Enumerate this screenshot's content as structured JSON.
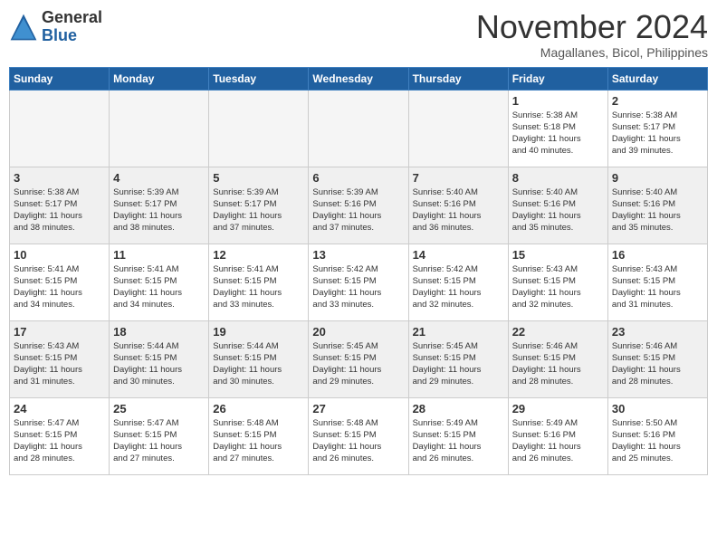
{
  "logo": {
    "general": "General",
    "blue": "Blue"
  },
  "title": "November 2024",
  "location": "Magallanes, Bicol, Philippines",
  "days_of_week": [
    "Sunday",
    "Monday",
    "Tuesday",
    "Wednesday",
    "Thursday",
    "Friday",
    "Saturday"
  ],
  "weeks": [
    [
      {
        "day": "",
        "info": ""
      },
      {
        "day": "",
        "info": ""
      },
      {
        "day": "",
        "info": ""
      },
      {
        "day": "",
        "info": ""
      },
      {
        "day": "",
        "info": ""
      },
      {
        "day": "1",
        "info": "Sunrise: 5:38 AM\nSunset: 5:18 PM\nDaylight: 11 hours\nand 40 minutes."
      },
      {
        "day": "2",
        "info": "Sunrise: 5:38 AM\nSunset: 5:17 PM\nDaylight: 11 hours\nand 39 minutes."
      }
    ],
    [
      {
        "day": "3",
        "info": "Sunrise: 5:38 AM\nSunset: 5:17 PM\nDaylight: 11 hours\nand 38 minutes."
      },
      {
        "day": "4",
        "info": "Sunrise: 5:39 AM\nSunset: 5:17 PM\nDaylight: 11 hours\nand 38 minutes."
      },
      {
        "day": "5",
        "info": "Sunrise: 5:39 AM\nSunset: 5:17 PM\nDaylight: 11 hours\nand 37 minutes."
      },
      {
        "day": "6",
        "info": "Sunrise: 5:39 AM\nSunset: 5:16 PM\nDaylight: 11 hours\nand 37 minutes."
      },
      {
        "day": "7",
        "info": "Sunrise: 5:40 AM\nSunset: 5:16 PM\nDaylight: 11 hours\nand 36 minutes."
      },
      {
        "day": "8",
        "info": "Sunrise: 5:40 AM\nSunset: 5:16 PM\nDaylight: 11 hours\nand 35 minutes."
      },
      {
        "day": "9",
        "info": "Sunrise: 5:40 AM\nSunset: 5:16 PM\nDaylight: 11 hours\nand 35 minutes."
      }
    ],
    [
      {
        "day": "10",
        "info": "Sunrise: 5:41 AM\nSunset: 5:15 PM\nDaylight: 11 hours\nand 34 minutes."
      },
      {
        "day": "11",
        "info": "Sunrise: 5:41 AM\nSunset: 5:15 PM\nDaylight: 11 hours\nand 34 minutes."
      },
      {
        "day": "12",
        "info": "Sunrise: 5:41 AM\nSunset: 5:15 PM\nDaylight: 11 hours\nand 33 minutes."
      },
      {
        "day": "13",
        "info": "Sunrise: 5:42 AM\nSunset: 5:15 PM\nDaylight: 11 hours\nand 33 minutes."
      },
      {
        "day": "14",
        "info": "Sunrise: 5:42 AM\nSunset: 5:15 PM\nDaylight: 11 hours\nand 32 minutes."
      },
      {
        "day": "15",
        "info": "Sunrise: 5:43 AM\nSunset: 5:15 PM\nDaylight: 11 hours\nand 32 minutes."
      },
      {
        "day": "16",
        "info": "Sunrise: 5:43 AM\nSunset: 5:15 PM\nDaylight: 11 hours\nand 31 minutes."
      }
    ],
    [
      {
        "day": "17",
        "info": "Sunrise: 5:43 AM\nSunset: 5:15 PM\nDaylight: 11 hours\nand 31 minutes."
      },
      {
        "day": "18",
        "info": "Sunrise: 5:44 AM\nSunset: 5:15 PM\nDaylight: 11 hours\nand 30 minutes."
      },
      {
        "day": "19",
        "info": "Sunrise: 5:44 AM\nSunset: 5:15 PM\nDaylight: 11 hours\nand 30 minutes."
      },
      {
        "day": "20",
        "info": "Sunrise: 5:45 AM\nSunset: 5:15 PM\nDaylight: 11 hours\nand 29 minutes."
      },
      {
        "day": "21",
        "info": "Sunrise: 5:45 AM\nSunset: 5:15 PM\nDaylight: 11 hours\nand 29 minutes."
      },
      {
        "day": "22",
        "info": "Sunrise: 5:46 AM\nSunset: 5:15 PM\nDaylight: 11 hours\nand 28 minutes."
      },
      {
        "day": "23",
        "info": "Sunrise: 5:46 AM\nSunset: 5:15 PM\nDaylight: 11 hours\nand 28 minutes."
      }
    ],
    [
      {
        "day": "24",
        "info": "Sunrise: 5:47 AM\nSunset: 5:15 PM\nDaylight: 11 hours\nand 28 minutes."
      },
      {
        "day": "25",
        "info": "Sunrise: 5:47 AM\nSunset: 5:15 PM\nDaylight: 11 hours\nand 27 minutes."
      },
      {
        "day": "26",
        "info": "Sunrise: 5:48 AM\nSunset: 5:15 PM\nDaylight: 11 hours\nand 27 minutes."
      },
      {
        "day": "27",
        "info": "Sunrise: 5:48 AM\nSunset: 5:15 PM\nDaylight: 11 hours\nand 26 minutes."
      },
      {
        "day": "28",
        "info": "Sunrise: 5:49 AM\nSunset: 5:15 PM\nDaylight: 11 hours\nand 26 minutes."
      },
      {
        "day": "29",
        "info": "Sunrise: 5:49 AM\nSunset: 5:16 PM\nDaylight: 11 hours\nand 26 minutes."
      },
      {
        "day": "30",
        "info": "Sunrise: 5:50 AM\nSunset: 5:16 PM\nDaylight: 11 hours\nand 25 minutes."
      }
    ]
  ]
}
